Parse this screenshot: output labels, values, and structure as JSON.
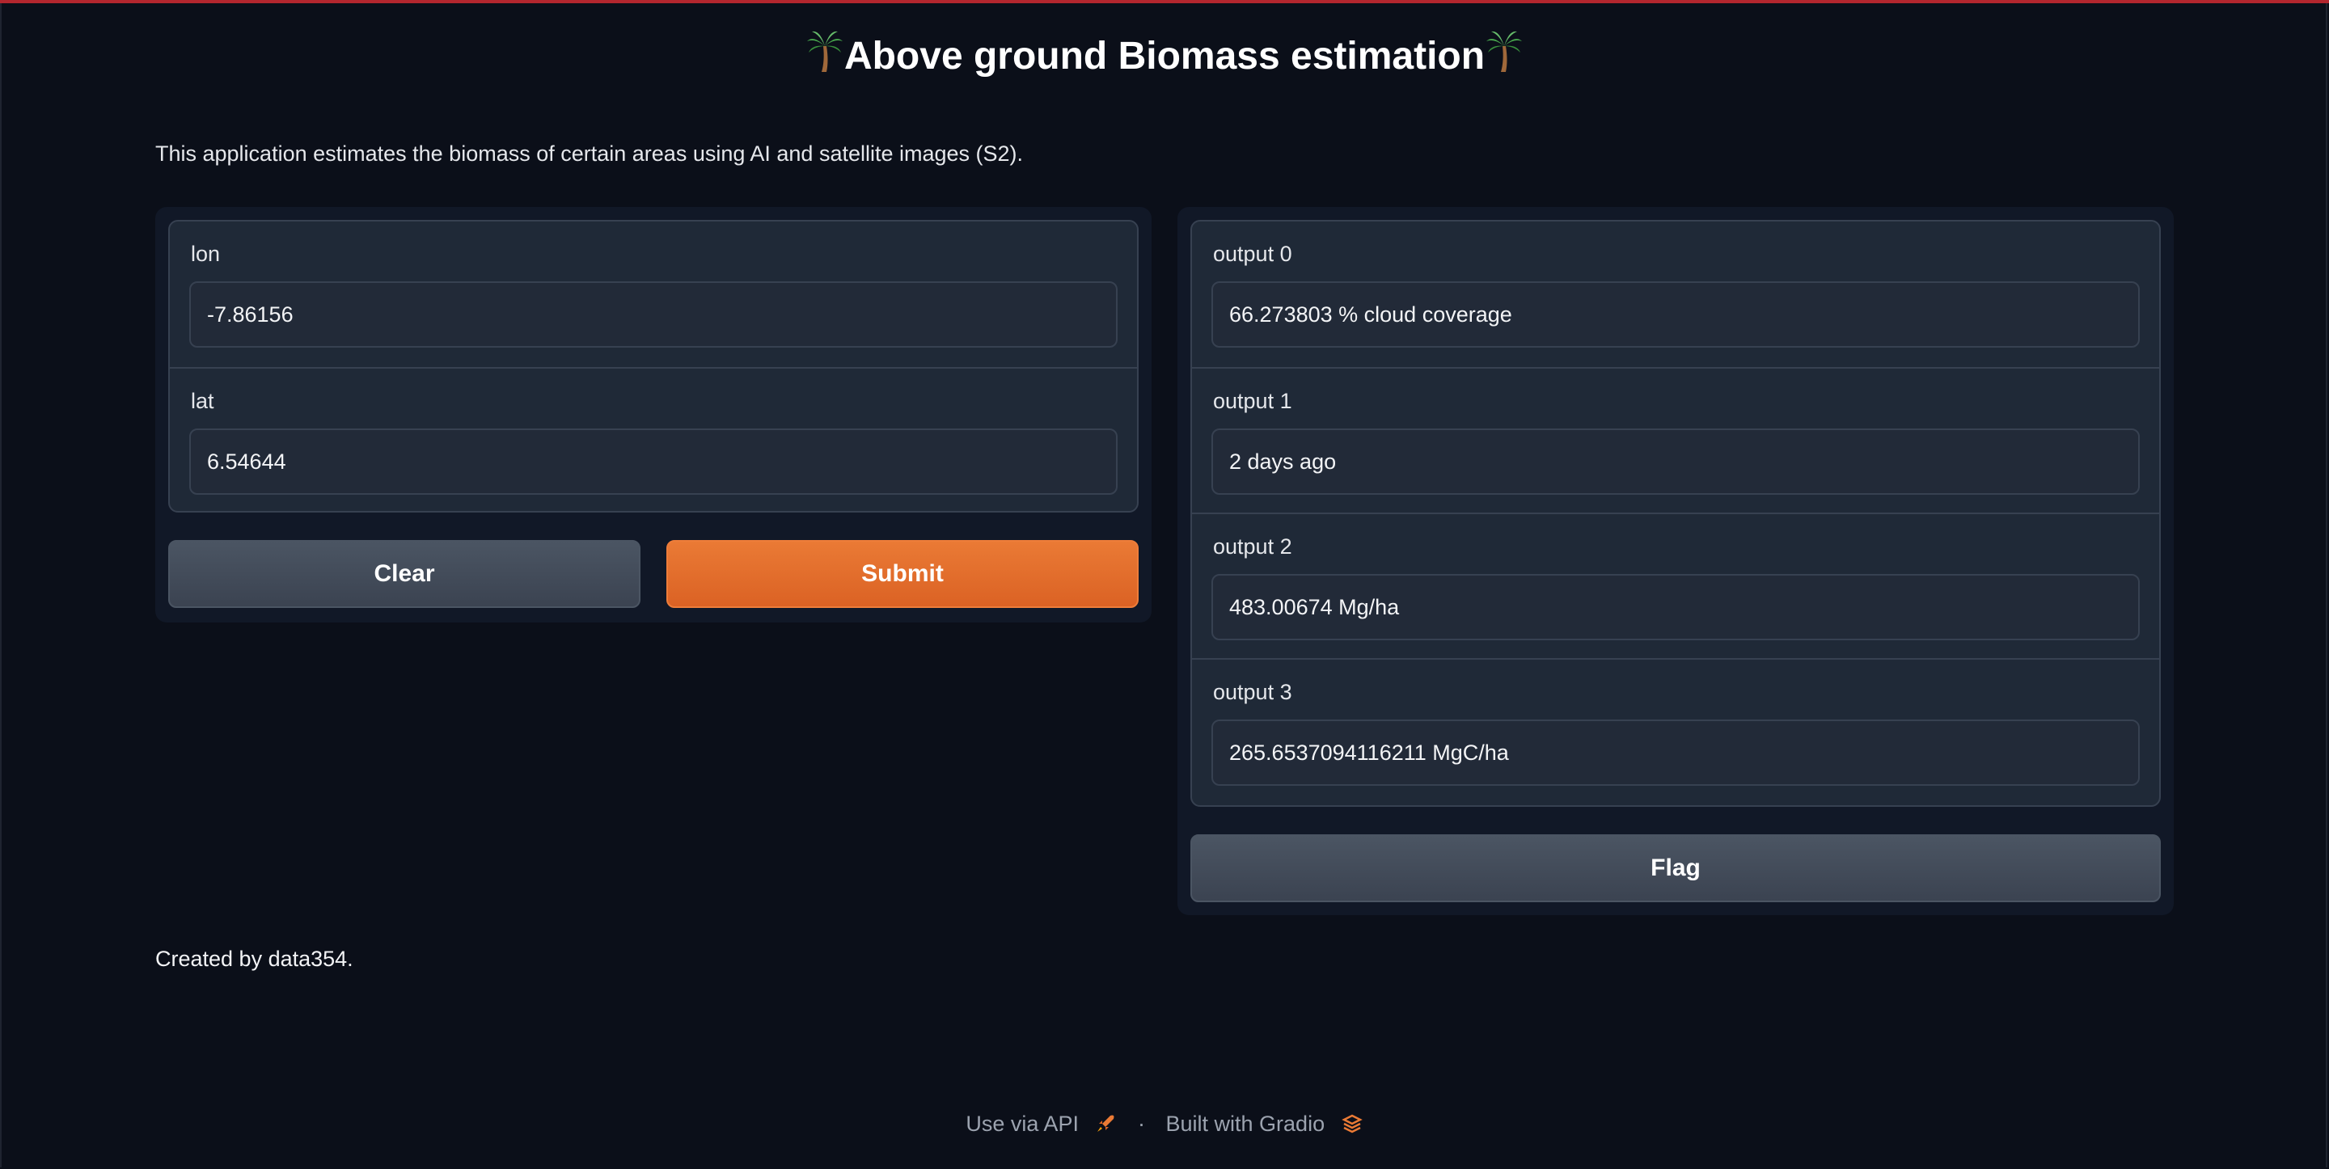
{
  "app": {
    "title": "Above ground Biomass estimation",
    "description": "This application estimates the biomass of certain areas using AI and satellite images (S2)."
  },
  "inputs": {
    "lon": {
      "label": "lon",
      "value": "-7.86156"
    },
    "lat": {
      "label": "lat",
      "value": "6.54644"
    }
  },
  "buttons": {
    "clear": "Clear",
    "submit": "Submit",
    "flag": "Flag"
  },
  "outputs": [
    {
      "label": "output 0",
      "value": "66.273803 % cloud coverage"
    },
    {
      "label": "output 1",
      "value": "2 days ago"
    },
    {
      "label": "output 2",
      "value": "483.00674 Mg/ha"
    },
    {
      "label": "output 3",
      "value": "265.6537094116211 MgC/ha"
    }
  ],
  "article": "Created by data354.",
  "footer": {
    "api": "Use via API",
    "separator": "·",
    "built": "Built with Gradio"
  },
  "colors": {
    "background": "#0b0f19",
    "accent": "#ea7a35",
    "panel": "#111827"
  },
  "icons": [
    "palm-tree-icon",
    "rocket-icon",
    "gradio-logo-icon"
  ]
}
